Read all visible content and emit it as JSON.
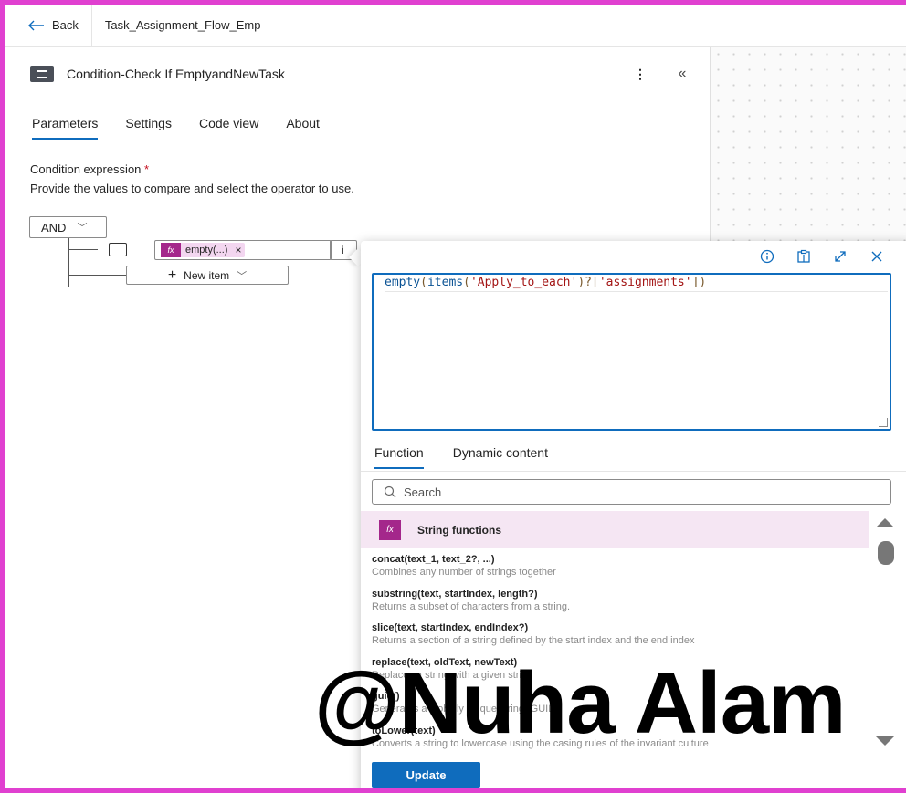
{
  "topbar": {
    "back_label": "Back",
    "flow_name": "Task_Assignment_Flow_Emp"
  },
  "panel": {
    "title": "Condition-Check If EmptyandNewTask",
    "more_icon": "more-vertical-icon",
    "collapse_icon": "collapse-icon",
    "tabs": [
      {
        "label": "Parameters",
        "active": true
      },
      {
        "label": "Settings",
        "active": false
      },
      {
        "label": "Code view",
        "active": false
      },
      {
        "label": "About",
        "active": false
      }
    ],
    "condition_label": "Condition expression",
    "required_mark": "*",
    "hint": "Provide the values to compare and select the operator to use.",
    "group_operator": "AND",
    "row": {
      "token_fx": "fx",
      "token_label": "empty(...)",
      "token_remove": "×",
      "operator_partial": "i"
    },
    "new_item_label": "New item"
  },
  "expression_editor": {
    "expression": {
      "fn": "empty",
      "open": "(",
      "fn2": "items",
      "arg": "'Apply_to_each'",
      "mid": ")?[",
      "key": "'assignments'",
      "close": "])"
    },
    "tabs": [
      {
        "label": "Function",
        "active": true
      },
      {
        "label": "Dynamic content",
        "active": false
      }
    ],
    "search_placeholder": "Search",
    "category": {
      "icon_label": "fx",
      "name": "String functions"
    },
    "functions": [
      {
        "signature": "concat(text_1, text_2?, ...)",
        "description": "Combines any number of strings together"
      },
      {
        "signature": "substring(text, startIndex, length?)",
        "description": "Returns a subset of characters from a string."
      },
      {
        "signature": "slice(text, startIndex, endIndex?)",
        "description": "Returns a section of a string defined by the start index and the end index"
      },
      {
        "signature": "replace(text, oldText, newText)",
        "description": "Replaces a string with a given string"
      },
      {
        "signature": "guid()",
        "description": "Generates a globally unique string (GUID)"
      },
      {
        "signature": "toLower(text)",
        "description": "Converts a string to lowercase using the casing rules of the invariant culture"
      }
    ],
    "update_label": "Update"
  },
  "watermark": "@Nuha Alam",
  "colors": {
    "accent": "#0f6cbd",
    "function_purple": "#a4278b",
    "category_bg": "#f5e6f3",
    "frame": "#e040d0"
  }
}
